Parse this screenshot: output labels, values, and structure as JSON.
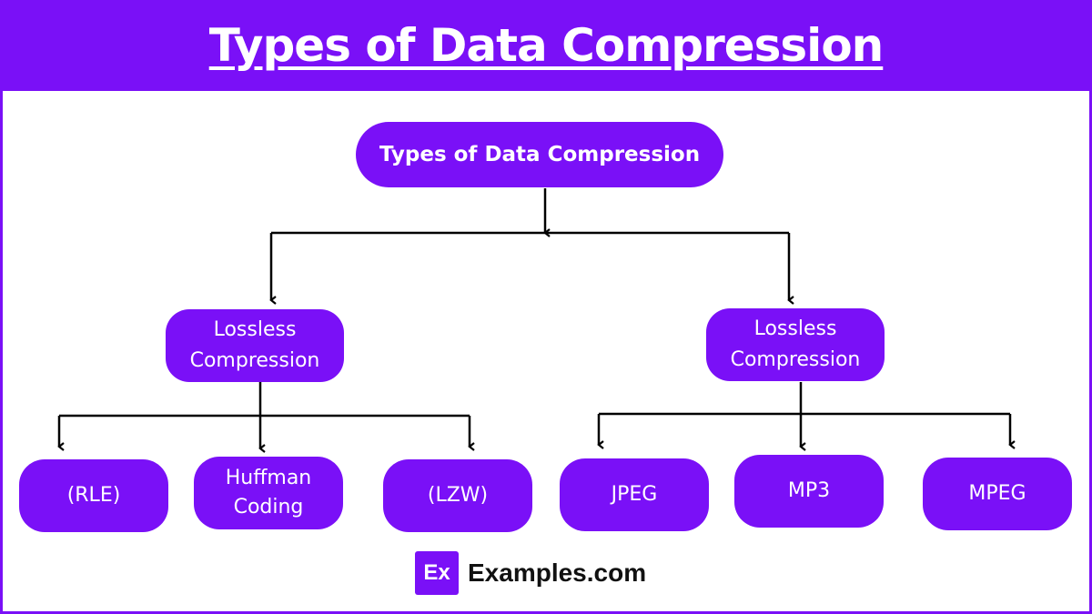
{
  "header": {
    "title": "Types of Data Compression"
  },
  "colors": {
    "accent": "#7a10f7",
    "background": "#ffffff",
    "connector": "#000000",
    "node_text": "#ffffff"
  },
  "diagram": {
    "root": {
      "label": "Types of Data Compression"
    },
    "branches": [
      {
        "label_line1": "Lossless",
        "label_line2": "Compression",
        "children": [
          {
            "line1": "(RLE)",
            "line2": ""
          },
          {
            "line1": "Huffman",
            "line2": "Coding"
          },
          {
            "line1": "(LZW)",
            "line2": ""
          }
        ]
      },
      {
        "label_line1": "Lossless",
        "label_line2": "Compression",
        "children": [
          {
            "line1": "JPEG",
            "line2": ""
          },
          {
            "line1": "MP3",
            "line2": ""
          },
          {
            "line1": "MPEG",
            "line2": ""
          }
        ]
      }
    ]
  },
  "footer": {
    "logo_mark": "Ex",
    "brand": "Examples.com"
  }
}
